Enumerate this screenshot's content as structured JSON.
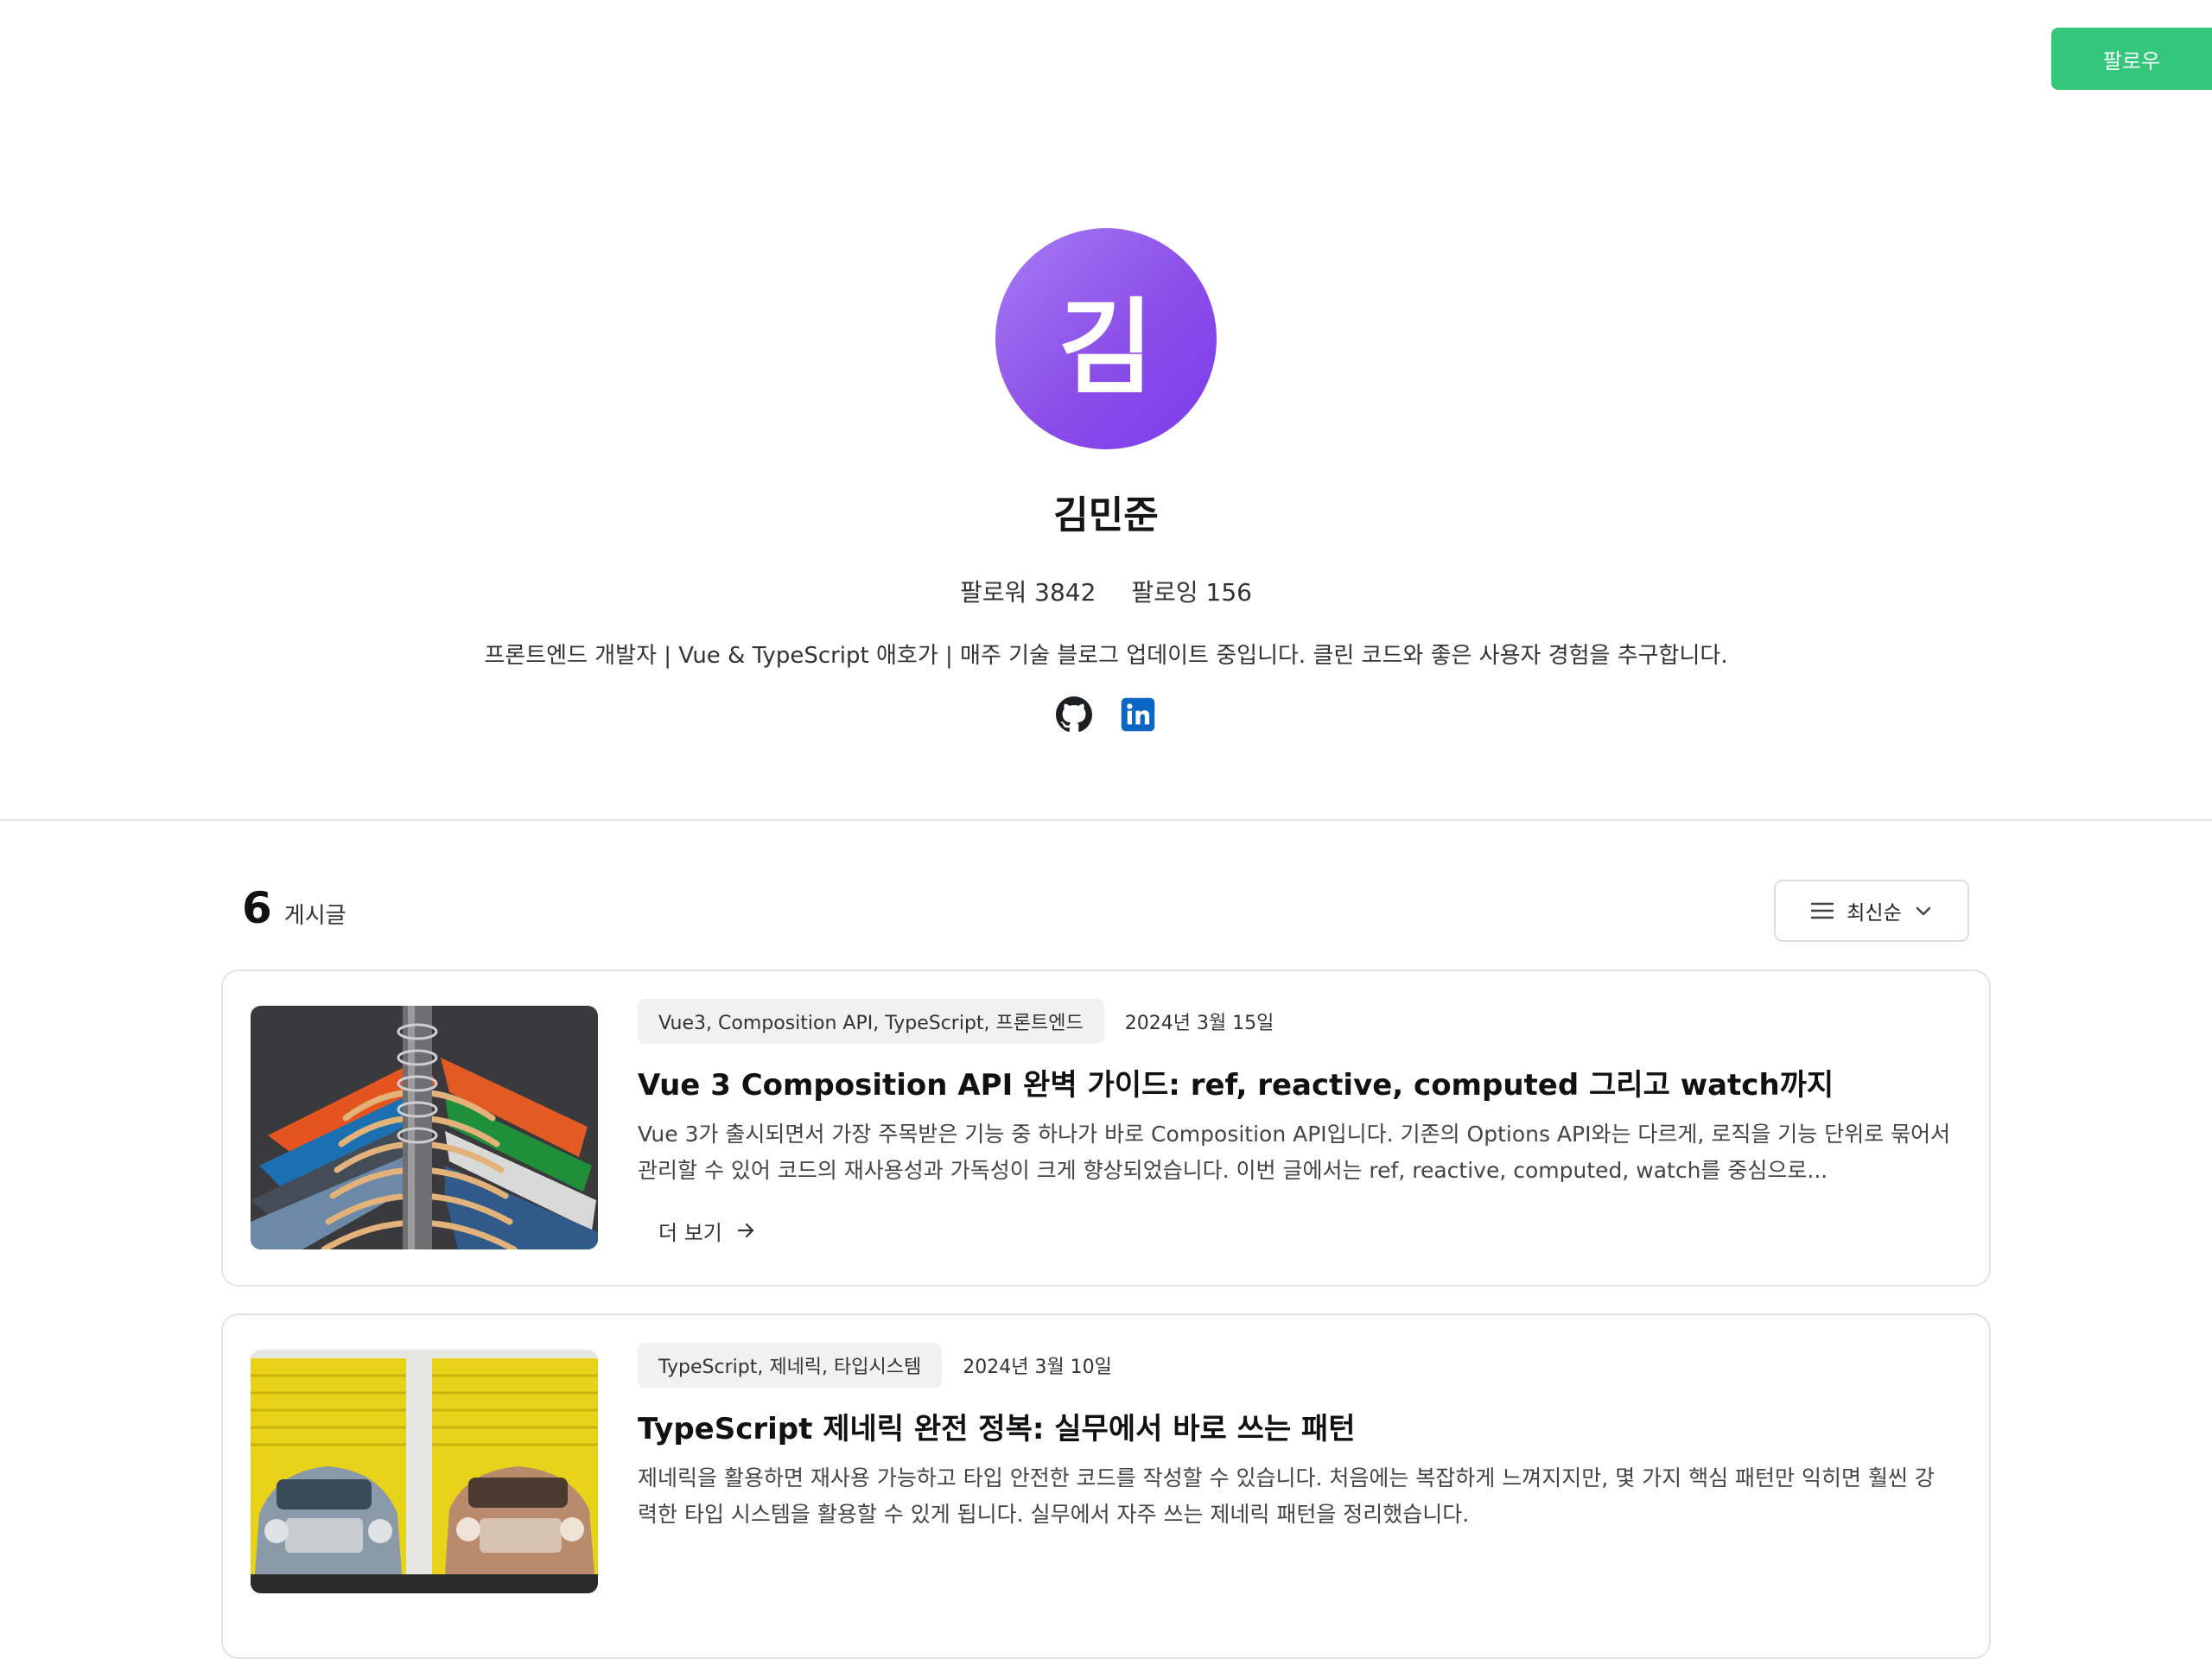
{
  "header": {
    "follow_label": "팔로우"
  },
  "profile": {
    "avatar_initial": "김",
    "name": "김민준",
    "followers_label": "팔로워 3842",
    "following_label": "팔로잉 156",
    "bio": "프론트엔드 개발자 | Vue & TypeScript 애호가 | 매주 기술 블로그 업데이트 중입니다. 클린 코드와 좋은 사용자 경험을 추구합니다.",
    "social_icons": [
      "github-icon",
      "linkedin-icon"
    ],
    "avatar_colors": [
      "#a77cf4",
      "#7c3aed"
    ]
  },
  "posts_header": {
    "count": "6",
    "count_label": "게시글",
    "sort_label": "최신순",
    "sort_icons": [
      "menu-icon",
      "chevron-down-icon"
    ]
  },
  "posts": [
    {
      "tags": "Vue3, Composition API, TypeScript, 프론트엔드",
      "date": "2024년 3월 15일",
      "title": "Vue 3 Composition API 완벽 가이드: ref, reactive, computed 그리고 watch까지",
      "excerpt": "Vue 3가 출시되면서 가장 주목받은 기능 중 하나가 바로 Composition API입니다. 기존의 Options API와는 다르게, 로직을 기능 단위로 묶어서 관리할 수 있어 코드의 재사용성과 가독성이 크게 향상되었습니다. 이번 글에서는 ref, reactive, computed, watch를 중심으로...",
      "read_more": "더 보기"
    },
    {
      "tags": "TypeScript, 제네릭, 타입시스템",
      "date": "2024년 3월 10일",
      "title": "TypeScript 제네릭 완전 정복: 실무에서 바로 쓰는 패턴",
      "excerpt": "제네릭을 활용하면 재사용 가능하고 타입 안전한 코드를 작성할 수 있습니다. 처음에는 복잡하게 느껴지지만, 몇 가지 핵심 패턴만 익히면 훨씬 강력한 타입 시스템을 활용할 수 있게 됩니다. 실무에서 자주 쓰는 제네릭 패턴을 정리했습니다."
    }
  ],
  "colors": {
    "accent": "#34c77b",
    "border": "#e3e3e3",
    "tag_bg": "#f1f1f2"
  }
}
